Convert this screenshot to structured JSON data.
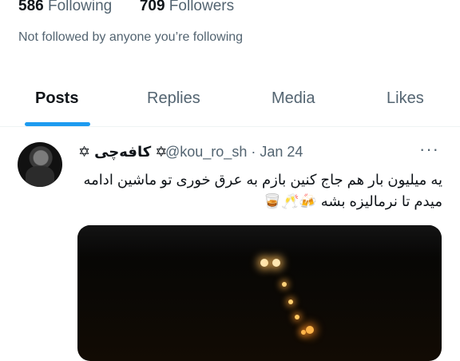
{
  "profile_stats": {
    "following_count": "586",
    "following_label": "Following",
    "followers_count": "709",
    "followers_label": "Followers",
    "not_followed_text": "Not followed by anyone you’re following"
  },
  "tabs": [
    {
      "label": "Posts",
      "active": true
    },
    {
      "label": "Replies",
      "active": false
    },
    {
      "label": "Media",
      "active": false
    },
    {
      "label": "Likes",
      "active": false
    }
  ],
  "tweet": {
    "display_name": "✡ کافه‌چی ✡",
    "handle": "@kou_ro_sh",
    "separator": "·",
    "date": "Jan 24",
    "more_icon": "more-horizontal-icon",
    "text": "یه میلیون بار هم جاج کنین بازم به عرق خوری تو ماشین ادامه میدم تا نرمالیزه بشه 🍻🥂🥃",
    "media_description_icon": "photo-night-road"
  },
  "colors": {
    "accent": "#1d9bf0",
    "text_primary": "#0f1419",
    "text_secondary": "#536471",
    "divider": "#eff3f4"
  }
}
